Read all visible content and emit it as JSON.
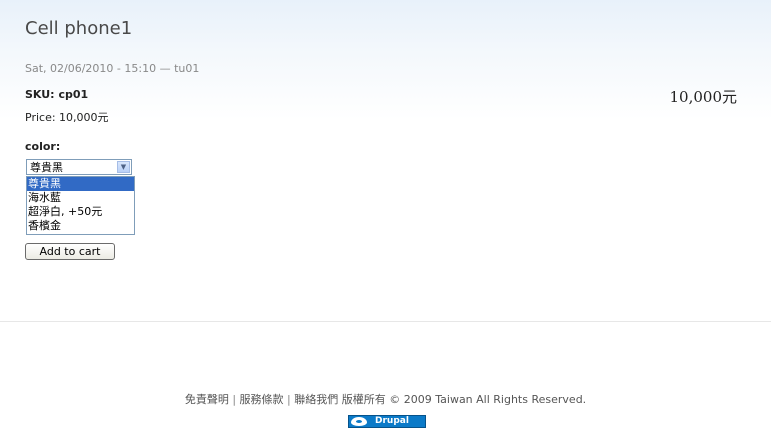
{
  "node": {
    "title": "Cell phone1",
    "submitted": "Sat, 02/06/2010 - 15:10 — tu01"
  },
  "product": {
    "sku_label": "SKU:",
    "sku": "cp01",
    "price_line": "Price: 10,000元",
    "display_price": "10,000元"
  },
  "attribute": {
    "label": "color:",
    "selected": "尊貴黑",
    "options": [
      "尊貴黑",
      "海水藍",
      "超淨白, +50元",
      "香檳金"
    ]
  },
  "actions": {
    "add_to_cart": "Add to cart"
  },
  "footer": {
    "link1": "免責聲明",
    "link2": "服務條款",
    "link3": "聯絡我們",
    "copyright": "版權所有 © 2009 Taiwan All Rights Reserved.",
    "separator": "|",
    "badge": "Drupal"
  },
  "colors": {
    "selection": "#316ac5",
    "badge": "#0b7ac8"
  }
}
